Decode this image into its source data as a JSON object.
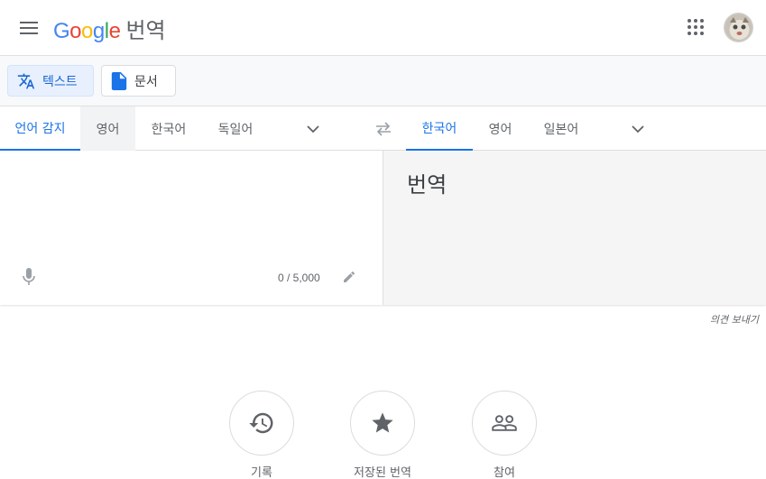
{
  "header": {
    "logo_letters": [
      "G",
      "o",
      "o",
      "g",
      "l",
      "e"
    ],
    "product_name": "번역",
    "colors": {
      "blue": "#4285f4",
      "red": "#ea4335",
      "yellow": "#fbbc05",
      "green": "#34a853"
    }
  },
  "modes": [
    {
      "label": "텍스트",
      "icon": "translate-icon",
      "active": true
    },
    {
      "label": "문서",
      "icon": "document-icon",
      "active": false
    }
  ],
  "source_languages": [
    "언어 감지",
    "영어",
    "한국어",
    "독일어"
  ],
  "target_languages": [
    "한국어",
    "영어",
    "일본어"
  ],
  "source": {
    "placeholder": "",
    "counter": "0 / 5,000"
  },
  "target": {
    "text": "번역"
  },
  "feedback_label": "의견 보내기",
  "bottom": [
    {
      "label": "기록",
      "icon": "history-icon"
    },
    {
      "label": "저장된 번역",
      "icon": "star-icon"
    },
    {
      "label": "참여",
      "icon": "community-icon"
    }
  ],
  "accent_color": "#1a73e8"
}
